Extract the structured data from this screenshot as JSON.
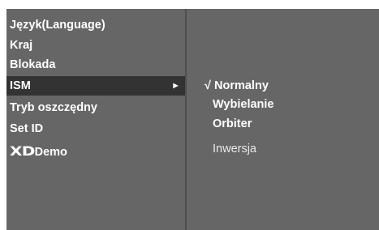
{
  "menu": {
    "items": [
      {
        "label": "Język(Language)"
      },
      {
        "label": "Kraj"
      },
      {
        "label": "Blokada"
      },
      {
        "label": "ISM",
        "arrow": "►"
      },
      {
        "label": "Tryb oszczędny"
      },
      {
        "label": "Set ID"
      },
      {
        "logo": "XD",
        "label": "Demo"
      }
    ],
    "selected_index": 3
  },
  "submenu": {
    "check_mark": "√",
    "options": [
      {
        "label": "Normalny",
        "checked": true
      },
      {
        "label": "Wybielanie"
      },
      {
        "label": "Orbiter"
      },
      {
        "label": "Inwersja",
        "disabled": true
      }
    ]
  },
  "colors": {
    "panel": "#666666",
    "highlight": "#333333",
    "text": "#ffffff"
  }
}
